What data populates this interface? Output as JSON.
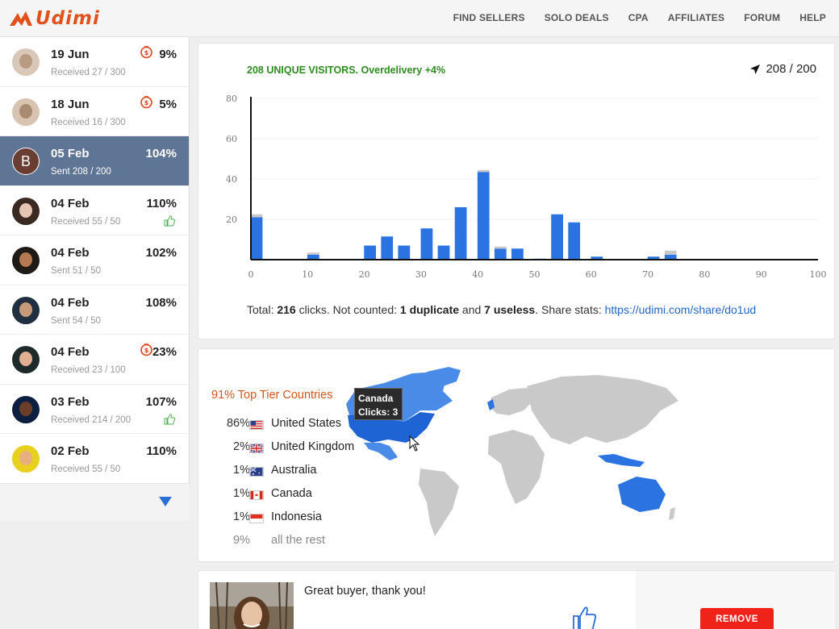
{
  "brand": {
    "name": "Udimi",
    "color": "#e0511b"
  },
  "nav": {
    "items": [
      "FIND SELLERS",
      "SOLO DEALS",
      "CPA",
      "AFFILIATES",
      "FORUM",
      "HELP"
    ]
  },
  "orders": [
    {
      "date": "19 Jun",
      "sub": "Received 27 / 300",
      "pct": "9%",
      "icon": "clock-dollar-icon",
      "avatar": "photo"
    },
    {
      "date": "18 Jun",
      "sub": "Received 16 / 300",
      "pct": "5%",
      "icon": "clock-dollar-icon",
      "avatar": "photo"
    },
    {
      "date": "05 Feb",
      "sub": "Sent 208 / 200",
      "pct": "104%",
      "icon": "",
      "avatar": "B",
      "selected": true
    },
    {
      "date": "04 Feb",
      "sub": "Received 55 / 50",
      "pct": "110%",
      "icon": "thumbs-up-icon",
      "avatar": "photo"
    },
    {
      "date": "04 Feb",
      "sub": "Sent 51 / 50",
      "pct": "102%",
      "icon": "",
      "avatar": "photo"
    },
    {
      "date": "04 Feb",
      "sub": "Sent 54 / 50",
      "pct": "108%",
      "icon": "",
      "avatar": "photo"
    },
    {
      "date": "04 Feb",
      "sub": "Received 23 / 100",
      "pct": "23%",
      "icon": "clock-dollar-icon",
      "avatar": "photo"
    },
    {
      "date": "03 Feb",
      "sub": "Received 214 / 200",
      "pct": "107%",
      "icon": "thumbs-up-icon",
      "avatar": "photo"
    },
    {
      "date": "02 Feb",
      "sub": "Received 55 / 50",
      "pct": "110%",
      "icon": "",
      "avatar": "photo"
    }
  ],
  "stats": {
    "heading": "208 UNIQUE VISITORS. Overdelivery +4%",
    "counter": "208 / 200",
    "totals": {
      "prefix": "Total: ",
      "clicks": "216",
      "mid1": " clicks. Not counted: ",
      "duplicate": "1 duplicate",
      "and": " and ",
      "useless": "7 useless",
      "mid2": ". Share stats: ",
      "link": "https://udimi.com/share/do1ud"
    }
  },
  "chart_data": {
    "type": "bar",
    "x": [
      1,
      4,
      7,
      11,
      14,
      17,
      21,
      24,
      27,
      31,
      34,
      37,
      41,
      44,
      47,
      51,
      54,
      57,
      61,
      64,
      67,
      71,
      74,
      77,
      81,
      84,
      87,
      91,
      94,
      97
    ],
    "series": [
      {
        "values": [
          21,
          0,
          0,
          2.5,
          0,
          0,
          7,
          11.5,
          7,
          15.5,
          7,
          26,
          43.5,
          5.5,
          5.5,
          0.5,
          22.5,
          18.5,
          1.5,
          0,
          0,
          1.5,
          2.5,
          0,
          0,
          0,
          0,
          0,
          0,
          0
        ]
      },
      {
        "values": [
          1.5,
          0,
          0,
          1,
          0,
          0,
          0,
          0,
          0,
          0,
          0,
          0,
          1,
          1,
          0,
          0,
          0,
          0,
          0,
          0,
          0,
          0,
          2,
          0,
          0,
          0,
          0,
          0,
          0,
          0
        ]
      }
    ],
    "x_ticks": [
      0,
      10,
      20,
      30,
      40,
      50,
      60,
      70,
      80,
      90,
      100
    ],
    "y_ticks": [
      20,
      40,
      60,
      80
    ],
    "xlim": [
      0,
      100
    ],
    "ylim": [
      0,
      80
    ],
    "colors": [
      "#2b73e0",
      "#c8c8c8"
    ]
  },
  "geo": {
    "heading": "91% Top Tier Countries",
    "countries": [
      {
        "pct": "86%",
        "name": "United States",
        "flag": "us-flag-icon"
      },
      {
        "pct": "2%",
        "name": "United Kingdom",
        "flag": "uk-flag-icon"
      },
      {
        "pct": "1%",
        "name": "Australia",
        "flag": "au-flag-icon"
      },
      {
        "pct": "1%",
        "name": "Canada",
        "flag": "ca-flag-icon"
      },
      {
        "pct": "1%",
        "name": "Indonesia",
        "flag": "id-flag-icon"
      },
      {
        "pct": "9%",
        "name": "all the rest",
        "flag": ""
      }
    ],
    "tooltip": {
      "country": "Canada",
      "clicks": "Clicks: 3"
    }
  },
  "review": {
    "text": "Great buyer, thank you!",
    "remove_label": "REMOVE"
  }
}
